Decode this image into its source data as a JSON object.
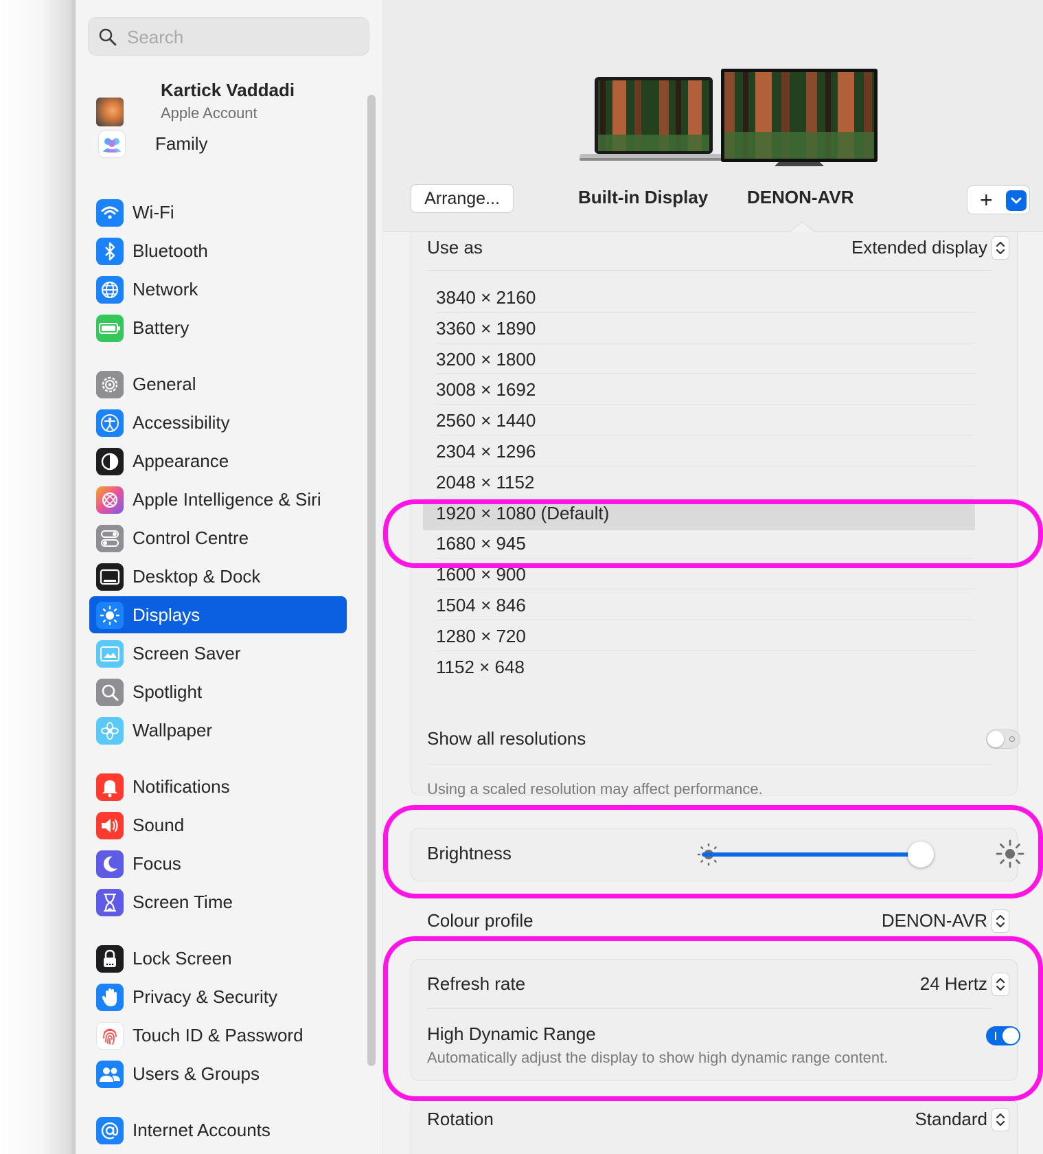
{
  "search": {
    "placeholder": "Search"
  },
  "account": {
    "name": "Kartick Vaddadi",
    "subtitle": "Apple Account"
  },
  "sidebar": {
    "family": "Family",
    "items": [
      {
        "label": "Wi-Fi",
        "icon": "wifi-icon",
        "color": "#1a82fb"
      },
      {
        "label": "Bluetooth",
        "icon": "bluetooth-icon",
        "color": "#1a82fb"
      },
      {
        "label": "Network",
        "icon": "globe-icon",
        "color": "#1a82fb"
      },
      {
        "label": "Battery",
        "icon": "battery-icon",
        "color": "#34c759"
      },
      {
        "label": "General",
        "icon": "gear-icon",
        "color": "#8e8e93"
      },
      {
        "label": "Accessibility",
        "icon": "accessibility-icon",
        "color": "#1a82fb"
      },
      {
        "label": "Appearance",
        "icon": "appearance-icon",
        "color": "#1d1d1f"
      },
      {
        "label": "Apple Intelligence & Siri",
        "icon": "siri-icon",
        "color": "#e85aa8"
      },
      {
        "label": "Control Centre",
        "icon": "control-centre-icon",
        "color": "#8e8e93"
      },
      {
        "label": "Desktop & Dock",
        "icon": "desktop-dock-icon",
        "color": "#1d1d1f"
      },
      {
        "label": "Displays",
        "icon": "sun-icon",
        "color": "#1a82fb"
      },
      {
        "label": "Screen Saver",
        "icon": "screen-saver-icon",
        "color": "#5ac8fa"
      },
      {
        "label": "Spotlight",
        "icon": "magnifier-icon",
        "color": "#8e8e93"
      },
      {
        "label": "Wallpaper",
        "icon": "flower-icon",
        "color": "#5ac8fa"
      },
      {
        "label": "Notifications",
        "icon": "bell-icon",
        "color": "#ff3b30"
      },
      {
        "label": "Sound",
        "icon": "speaker-icon",
        "color": "#ff3b30"
      },
      {
        "label": "Focus",
        "icon": "moon-icon",
        "color": "#5e5ce6"
      },
      {
        "label": "Screen Time",
        "icon": "hourglass-icon",
        "color": "#5e5ce6"
      },
      {
        "label": "Lock Screen",
        "icon": "lock-icon",
        "color": "#1d1d1f"
      },
      {
        "label": "Privacy & Security",
        "icon": "hand-icon",
        "color": "#1a82fb"
      },
      {
        "label": "Touch ID & Password",
        "icon": "fingerprint-icon",
        "color": "#ff6f6f"
      },
      {
        "label": "Users & Groups",
        "icon": "users-icon",
        "color": "#1a82fb"
      },
      {
        "label": "Internet Accounts",
        "icon": "at-icon",
        "color": "#1a82fb"
      }
    ],
    "selected": "Displays"
  },
  "displays": {
    "arrange_button": "Arrange...",
    "builtin_label": "Built-in Display",
    "external_label": "DENON-AVR",
    "add_button": "+"
  },
  "settings": {
    "use_as_label": "Use as",
    "use_as_value": "Extended display",
    "resolutions": [
      "3840 × 2160",
      "3360 × 1890",
      "3200 × 1800",
      "3008 × 1692",
      "2560 × 1440",
      "2304 × 1296",
      "2048 × 1152",
      "1920 × 1080 (Default)",
      "1680 × 945",
      "1600 × 900",
      "1504 × 846",
      "1280 × 720",
      "1152 × 648"
    ],
    "selected_resolution": "1920 × 1080 (Default)",
    "show_all_label": "Show all resolutions",
    "show_all_on": false,
    "scaled_note": "Using a scaled resolution may affect performance.",
    "brightness_label": "Brightness",
    "brightness_value": 0.95,
    "colour_profile_label": "Colour profile",
    "colour_profile_value": "DENON-AVR",
    "refresh_label": "Refresh rate",
    "refresh_value": "24 Hertz",
    "hdr_label": "High Dynamic Range",
    "hdr_desc": "Automatically adjust the display to show high dynamic range content.",
    "hdr_on": true,
    "rotation_label": "Rotation",
    "rotation_value": "Standard"
  },
  "colors": {
    "accent": "#0a60e0",
    "highlight": "#ff14e6"
  }
}
